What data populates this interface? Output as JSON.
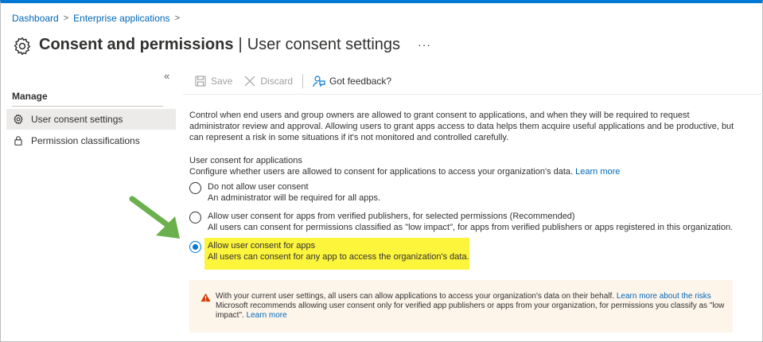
{
  "breadcrumb": [
    "Dashboard",
    "Enterprise applications"
  ],
  "header": {
    "title": "Consent and permissions",
    "subtitle": "User consent settings",
    "more": "···"
  },
  "sidebar": {
    "collapse": "«",
    "section": "Manage",
    "items": [
      {
        "label": "User consent settings",
        "icon": "gear-icon",
        "active": true
      },
      {
        "label": "Permission classifications",
        "icon": "lock-icon",
        "active": false
      }
    ]
  },
  "toolbar": {
    "save": "Save",
    "discard": "Discard",
    "feedback": "Got feedback?"
  },
  "description": "Control when end users and group owners are allowed to grant consent to applications, and when they will be required to request administrator review and approval. Allowing users to grant apps access to data helps them acquire useful applications and be productive, but can represent a risk in some situations if it's not monitored and controlled carefully.",
  "section": {
    "title": "User consent for applications",
    "desc": "Configure whether users are allowed to consent for applications to access your organization's data.",
    "learn_more": "Learn more"
  },
  "options": [
    {
      "label": "Do not allow user consent",
      "desc": "An administrator will be required for all apps.",
      "checked": false
    },
    {
      "label": "Allow user consent for apps from verified publishers, for selected permissions (Recommended)",
      "desc": "All users can consent for permissions classified as \"low impact\", for apps from verified publishers or apps registered in this organization.",
      "checked": false
    },
    {
      "label": "Allow user consent for apps",
      "desc": "All users can consent for any app to access the organization's data.",
      "checked": true
    }
  ],
  "warning": {
    "line1": "With your current user settings, all users can allow applications to access your organization's data on their behalf.",
    "link1": "Learn more about the risks",
    "line2": "Microsoft recommends allowing user consent only for verified app publishers or apps from your organization, for permissions you classify as \"low impact\".",
    "link2": "Learn more"
  },
  "colors": {
    "accent": "#0078d4",
    "highlight": "#fdf53c",
    "arrow": "#6ab04c",
    "warning_bg": "#fdf4ea"
  }
}
